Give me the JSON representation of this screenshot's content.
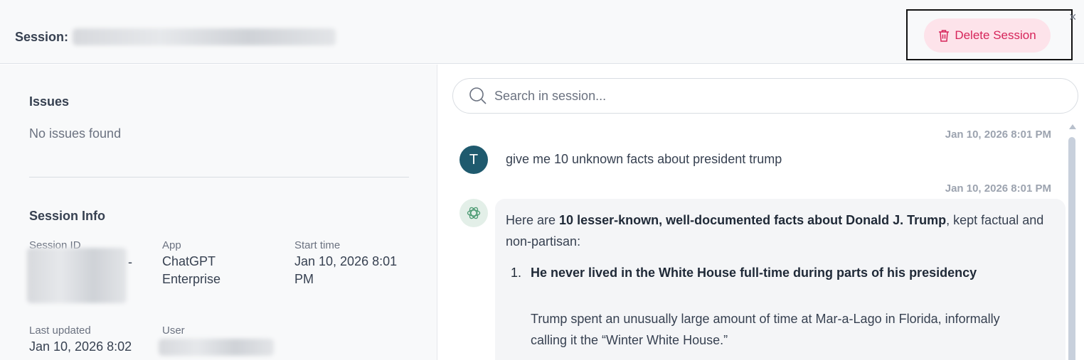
{
  "header": {
    "session_label": "Session:",
    "delete_label": "Delete Session",
    "close_symbol": "×"
  },
  "left": {
    "issues_title": "Issues",
    "no_issues": "No issues found",
    "info_title": "Session Info",
    "session_id_label": "Session ID",
    "app_label": "App",
    "app_value_line1": "ChatGPT",
    "app_value_line2": "Enterprise",
    "start_label": "Start time",
    "start_value_line1": "Jan 10, 2026 8:01",
    "start_value_line2": "PM",
    "updated_label": "Last updated",
    "updated_value": "Jan 10, 2026 8:02",
    "user_label": "User"
  },
  "search": {
    "placeholder": "Search in session..."
  },
  "chat": {
    "messages": [
      {
        "role": "user",
        "avatar_initial": "T",
        "timestamp": "Jan 10, 2026 8:01 PM",
        "text": "give me 10 unknown facts about president trump"
      },
      {
        "role": "assistant",
        "avatar_icon": "openai-logo-icon",
        "timestamp": "Jan 10, 2026 8:01 PM",
        "intro_pre": "Here are ",
        "intro_bold": "10 lesser-known, well-documented facts about Donald J. Trump",
        "intro_post": ", kept factual and non-partisan:",
        "facts": [
          {
            "number": "1.",
            "title": "He never lived in the White House full-time during parts of his presidency",
            "body": "Trump spent an unusually large amount of time at Mar-a-Lago in Florida, informally calling it the “Winter White House.”"
          }
        ]
      }
    ]
  },
  "colors": {
    "delete_bg": "#fde3ea",
    "delete_text": "#d6245a",
    "user_avatar": "#1f5a6e",
    "gpt_avatar_bg": "#e3efe8"
  }
}
